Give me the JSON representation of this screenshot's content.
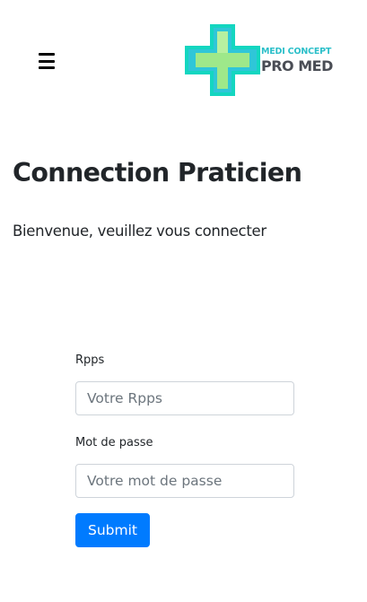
{
  "header": {
    "menu_icon": "hamburger-menu-icon",
    "logo": {
      "line1": "MEDI CONCEPT",
      "line2": "PRO MED",
      "colors": {
        "cross_outer": "#1ad4c2",
        "cross_middle": "#2ec4d4",
        "cross_inner": "#9ee88a",
        "text_top": "#2bbfc9",
        "text_bottom": "#4a4d55"
      }
    }
  },
  "main": {
    "title": "Connection Praticien",
    "subtitle": "Bienvenue, veuillez vous connecter"
  },
  "form": {
    "rpps": {
      "label": "Rpps",
      "placeholder": "Votre Rpps",
      "value": ""
    },
    "password": {
      "label": "Mot de passe",
      "placeholder": "Votre mot de passe",
      "value": ""
    },
    "submit_label": "Submit"
  },
  "colors": {
    "primary": "#007bff",
    "text": "#212529",
    "input_border": "#ced4da"
  }
}
